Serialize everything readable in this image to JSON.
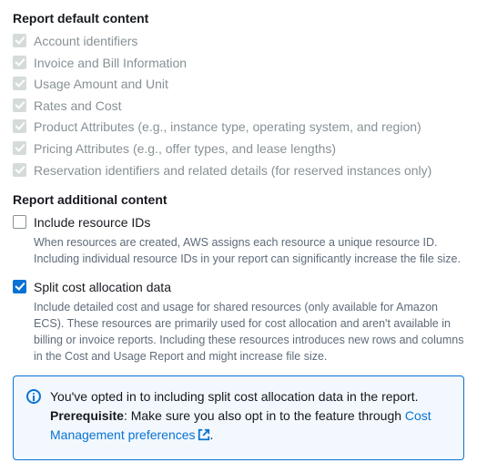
{
  "default_section": {
    "title": "Report default content",
    "items": [
      "Account identifiers",
      "Invoice and Bill Information",
      "Usage Amount and Unit",
      "Rates and Cost",
      "Product Attributes (e.g., instance type, operating system, and region)",
      "Pricing Attributes (e.g., offer types, and lease lengths)",
      "Reservation identifiers and related details (for reserved instances only)"
    ]
  },
  "additional_section": {
    "title": "Report additional content",
    "items": [
      {
        "label": "Include resource IDs",
        "desc": "When resources are created, AWS assigns each resource a unique resource ID. Including individual resource IDs in your report can significantly increase the file size.",
        "checked": false
      },
      {
        "label": "Split cost allocation data",
        "desc": "Include detailed cost and usage for shared resources (only available for Amazon ECS). These resources are primarily used for cost allocation and aren't available in billing or invoice reports. Including these resources introduces new rows and columns in the Cost and Usage Report and might increase file size.",
        "checked": true
      }
    ]
  },
  "info": {
    "line1": "You've opted in to including split cost allocation data in the report.",
    "prereq_label": "Prerequisite",
    "prereq_text": ": Make sure you also opt in to the feature through ",
    "link_text": "Cost Management preferences",
    "trailing": "."
  }
}
